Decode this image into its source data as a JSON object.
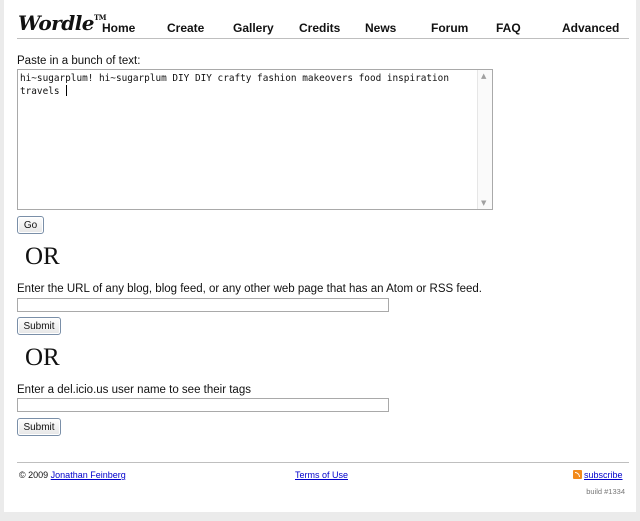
{
  "brand": {
    "logo": "Wordle",
    "tm": "TM"
  },
  "nav": [
    {
      "label": "Home"
    },
    {
      "label": "Create"
    },
    {
      "label": "Gallery"
    },
    {
      "label": "Credits"
    },
    {
      "label": "News"
    },
    {
      "label": "Forum"
    },
    {
      "label": "FAQ"
    },
    {
      "label": "Advanced"
    }
  ],
  "text_section": {
    "label": "Paste in a bunch of text:",
    "value": "hi~sugarplum! hi~sugarplum DIY DIY crafty fashion makeovers food inspiration travels ",
    "go_label": "Go"
  },
  "or_text": "OR",
  "url_section": {
    "label": "Enter the URL of any blog, blog feed, or any other web page that has an Atom or RSS feed.",
    "value": "",
    "submit_label": "Submit"
  },
  "delicious_section": {
    "label": "Enter a del.icio.us user name to see their tags",
    "value": "",
    "submit_label": "Submit"
  },
  "footer": {
    "copyright": "© 2009",
    "author": "Jonathan Feinberg",
    "terms": "Terms of Use",
    "subscribe": "subscribe",
    "build": "build #1334"
  },
  "colors": {
    "link": "#0000cc",
    "rss": "#f28a1c"
  }
}
